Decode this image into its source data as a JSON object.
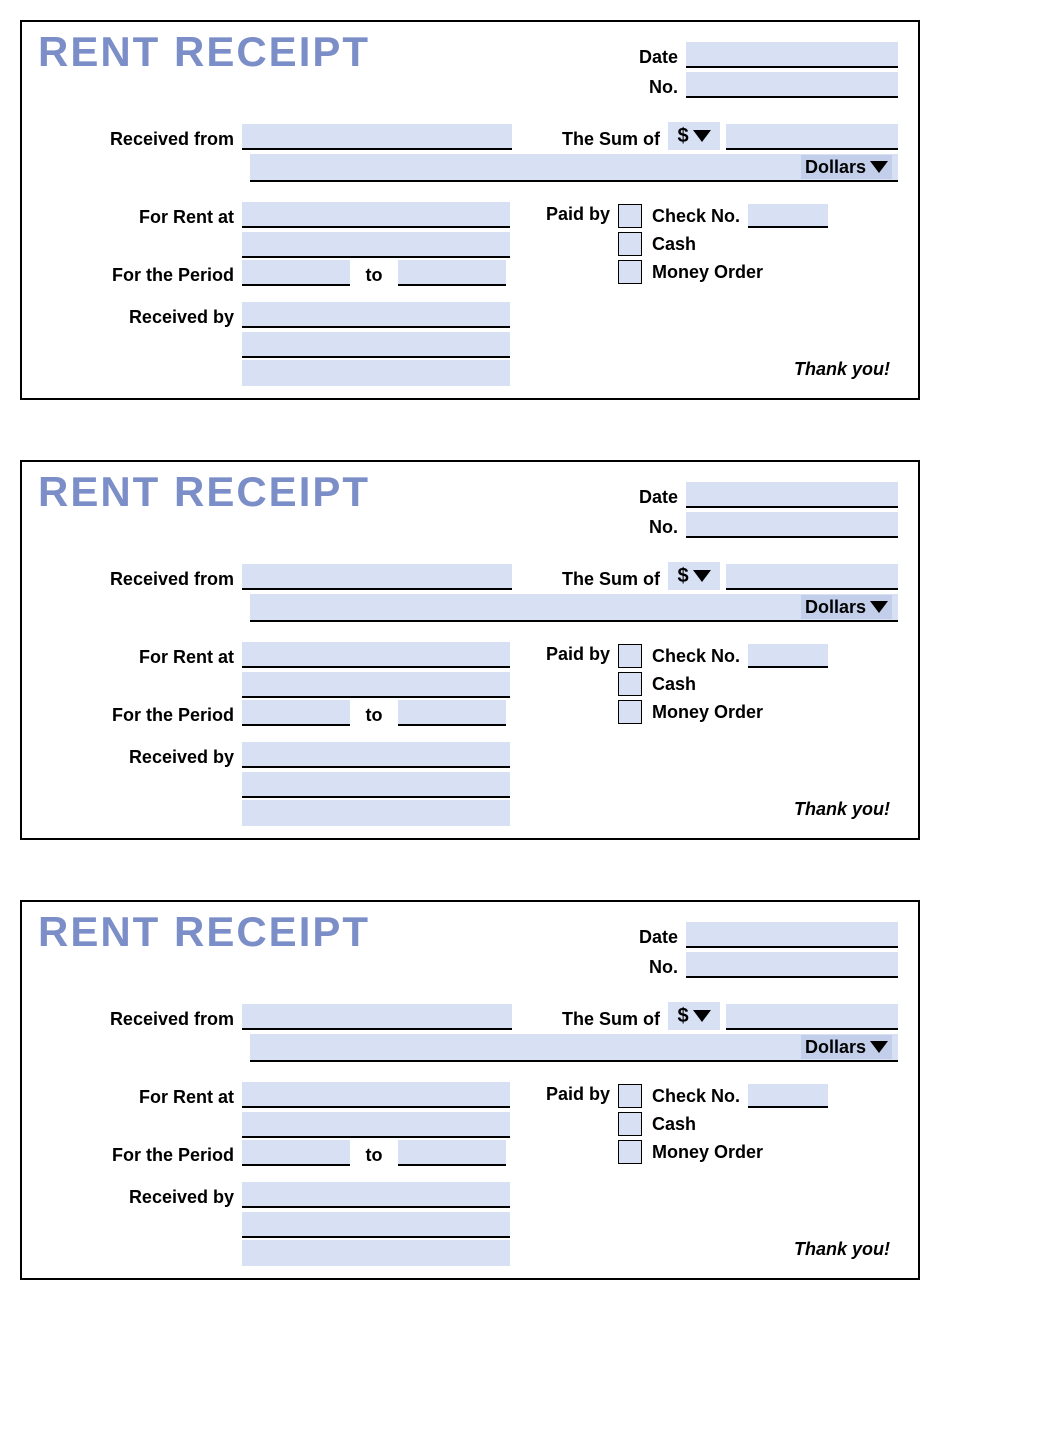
{
  "title": "RENT RECEIPT",
  "labels": {
    "date": "Date",
    "no": "No.",
    "received_from": "Received from",
    "sum_of": "The Sum of",
    "currency": "$",
    "dollars": "Dollars",
    "for_rent_at": "For Rent at",
    "for_period": "For the Period",
    "to": "to",
    "received_by": "Received by",
    "paid_by": "Paid by",
    "check_no": "Check No.",
    "cash": "Cash",
    "money_order": "Money Order"
  },
  "footer": "Thank you!",
  "fields": {
    "date": "",
    "no": "",
    "received_from": "",
    "sum_amount": "",
    "sum_words": "",
    "for_rent_line1": "",
    "for_rent_line2": "",
    "period_from": "",
    "period_to": "",
    "received_by_line1": "",
    "received_by_line2": "",
    "received_by_line3": "",
    "check_no_value": ""
  },
  "receipt_count": 3
}
